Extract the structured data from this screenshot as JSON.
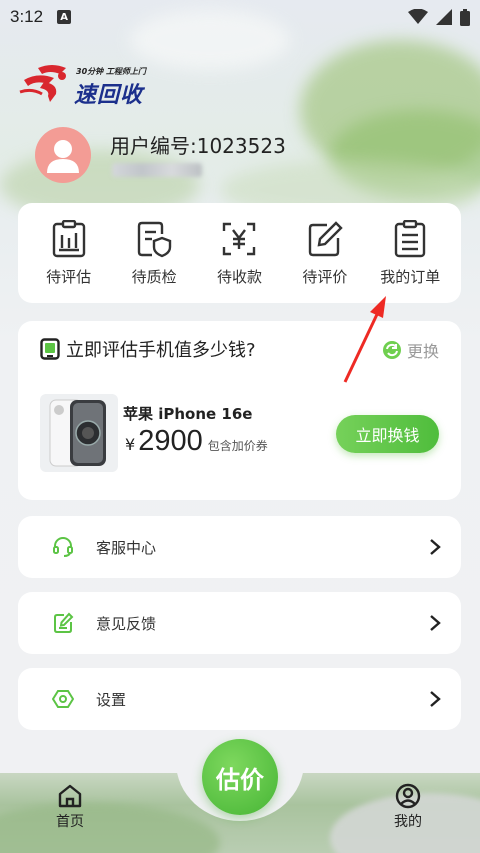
{
  "status_bar": {
    "time": "3:12",
    "notif_letter": "A"
  },
  "logo": {
    "slogan": "30分钟 工程师上门",
    "name": "速回收"
  },
  "user": {
    "id_text": "用户编号:1023523"
  },
  "orders": [
    {
      "label": "待评估",
      "icon": "clipboard-chart-icon"
    },
    {
      "label": "待质检",
      "icon": "shield-doc-icon"
    },
    {
      "label": "待收款",
      "icon": "yuan-scan-icon"
    },
    {
      "label": "待评价",
      "icon": "edit-icon"
    },
    {
      "label": "我的订单",
      "icon": "list-doc-icon"
    }
  ],
  "estimate": {
    "title": "立即评估手机值多少钱?",
    "swap_label": "更换",
    "phone_name": "苹果 iPhone 16e",
    "currency": "¥",
    "price": "2900",
    "price_note": "包含加价券",
    "button": "立即换钱"
  },
  "menu": [
    {
      "label": "客服中心",
      "icon": "headset-icon"
    },
    {
      "label": "意见反馈",
      "icon": "feedback-icon"
    },
    {
      "label": "设置",
      "icon": "settings-icon"
    }
  ],
  "nav": {
    "home": "首页",
    "estimate": "估价",
    "mine": "我的"
  },
  "colors": {
    "accent_green": "#5cc445",
    "logo_blue": "#1b2f8c",
    "logo_red": "#d9272e",
    "annotation_red": "#ee2a24"
  }
}
